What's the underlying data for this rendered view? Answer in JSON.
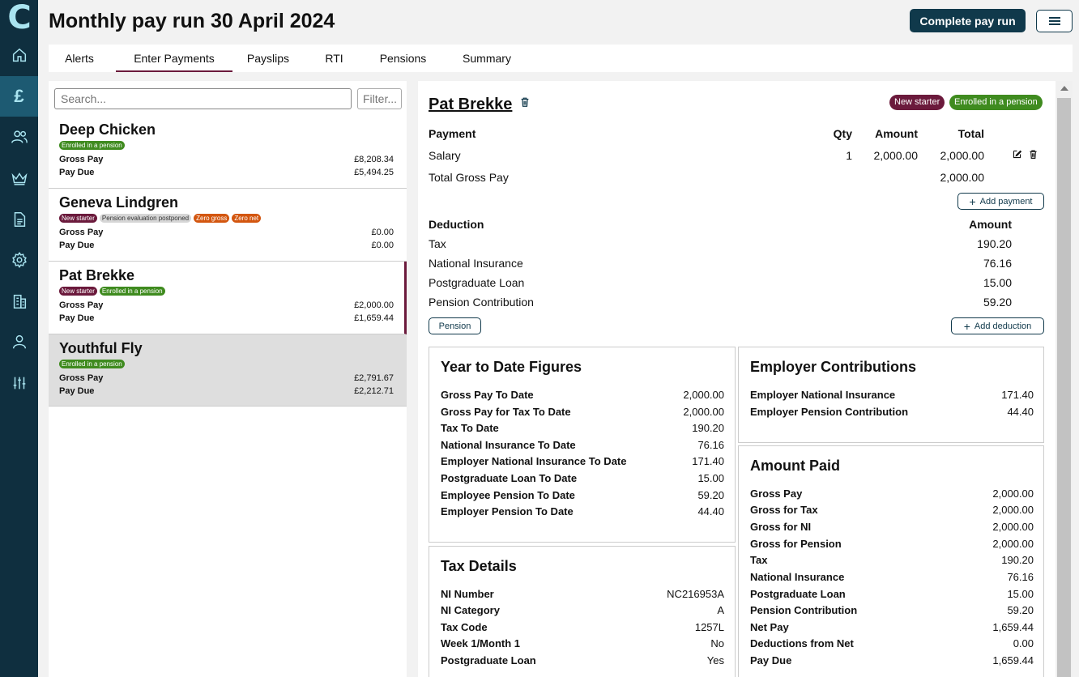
{
  "app": {
    "logo": "C",
    "title": "Monthly pay run 30 April 2024"
  },
  "header": {
    "complete_label": "Complete pay run",
    "menu_icon": "hamburger-icon"
  },
  "nav": [
    {
      "icon": "home-icon"
    },
    {
      "icon": "pound-icon",
      "symbol": "£",
      "active": true
    },
    {
      "icon": "people-icon"
    },
    {
      "icon": "crown-icon"
    },
    {
      "icon": "document-icon"
    },
    {
      "icon": "gear-icon"
    },
    {
      "icon": "building-icon"
    },
    {
      "icon": "user-icon"
    },
    {
      "icon": "sliders-icon"
    }
  ],
  "tabs": [
    {
      "label": "Alerts"
    },
    {
      "label": "Enter Payments",
      "active": true
    },
    {
      "label": "Payslips"
    },
    {
      "label": "RTI"
    },
    {
      "label": "Pensions"
    },
    {
      "label": "Summary"
    }
  ],
  "search": {
    "placeholder": "Search...",
    "filter_placeholder": "Filter..."
  },
  "employees": [
    {
      "name": "Deep Chicken",
      "badges": [
        "Enrolled in a pension"
      ],
      "gross_label": "Gross Pay",
      "gross": "£8,208.34",
      "due_label": "Pay Due",
      "due": "£5,494.25"
    },
    {
      "name": "Geneva Lindgren",
      "badges": [
        "New starter",
        "Pension evaluation postponed",
        "Zero gross",
        "Zero net"
      ],
      "gross_label": "Gross Pay",
      "gross": "£0.00",
      "due_label": "Pay Due",
      "due": "£0.00"
    },
    {
      "name": "Pat Brekke",
      "badges": [
        "New starter",
        "Enrolled in a pension"
      ],
      "gross_label": "Gross Pay",
      "gross": "£2,000.00",
      "due_label": "Pay Due",
      "due": "£1,659.44"
    },
    {
      "name": "Youthful Fly",
      "badges": [
        "Enrolled in a pension"
      ],
      "gross_label": "Gross Pay",
      "gross": "£2,791.67",
      "due_label": "Pay Due",
      "due": "£2,212.71"
    }
  ],
  "detail": {
    "name": "Pat Brekke",
    "badges": [
      "New starter",
      "Enrolled in a pension"
    ],
    "payment_headers": {
      "payment": "Payment",
      "qty": "Qty",
      "amount": "Amount",
      "total": "Total"
    },
    "payments": [
      {
        "name": "Salary",
        "qty": "1",
        "amount": "2,000.00",
        "total": "2,000.00"
      }
    ],
    "total_gross_label": "Total Gross Pay",
    "total_gross": "2,000.00",
    "add_payment": "Add payment",
    "deduction_headers": {
      "deduction": "Deduction",
      "amount": "Amount"
    },
    "deductions": [
      {
        "name": "Tax",
        "amount": "190.20"
      },
      {
        "name": "National Insurance",
        "amount": "76.16"
      },
      {
        "name": "Postgraduate Loan",
        "amount": "15.00"
      },
      {
        "name": "Pension Contribution",
        "amount": "59.20"
      }
    ],
    "pension_button": "Pension",
    "add_deduction": "Add deduction",
    "ytd": {
      "title": "Year to Date Figures",
      "rows": [
        {
          "k": "Gross Pay To Date",
          "v": "2,000.00"
        },
        {
          "k": "Gross Pay for Tax To Date",
          "v": "2,000.00"
        },
        {
          "k": "Tax To Date",
          "v": "190.20"
        },
        {
          "k": "National Insurance To Date",
          "v": "76.16"
        },
        {
          "k": "Employer National Insurance To Date",
          "v": "171.40"
        },
        {
          "k": "Postgraduate Loan To Date",
          "v": "15.00"
        },
        {
          "k": "Employee Pension To Date",
          "v": "59.20"
        },
        {
          "k": "Employer Pension To Date",
          "v": "44.40"
        }
      ]
    },
    "employer": {
      "title": "Employer Contributions",
      "rows": [
        {
          "k": "Employer National Insurance",
          "v": "171.40"
        },
        {
          "k": "Employer Pension Contribution",
          "v": "44.40"
        }
      ]
    },
    "tax": {
      "title": "Tax Details",
      "rows": [
        {
          "k": "NI Number",
          "v": "NC216953A"
        },
        {
          "k": "NI Category",
          "v": "A"
        },
        {
          "k": "Tax Code",
          "v": "1257L"
        },
        {
          "k": "Week 1/Month 1",
          "v": "No"
        },
        {
          "k": "Postgraduate Loan",
          "v": "Yes"
        }
      ]
    },
    "paid": {
      "title": "Amount Paid",
      "rows": [
        {
          "k": "Gross Pay",
          "v": "2,000.00"
        },
        {
          "k": "Gross for Tax",
          "v": "2,000.00"
        },
        {
          "k": "Gross for NI",
          "v": "2,000.00"
        },
        {
          "k": "Gross for Pension",
          "v": "2,000.00"
        },
        {
          "k": "Tax",
          "v": "190.20"
        },
        {
          "k": "National Insurance",
          "v": "76.16"
        },
        {
          "k": "Postgraduate Loan",
          "v": "15.00"
        },
        {
          "k": "Pension Contribution",
          "v": "59.20"
        },
        {
          "k": "Net Pay",
          "v": "1,659.44"
        },
        {
          "k": "Deductions from Net",
          "v": "0.00"
        },
        {
          "k": "Pay Due",
          "v": "1,659.44"
        }
      ]
    }
  },
  "colors": {
    "sidebar": "#0f2f3f",
    "accent": "#10394b",
    "maroon": "#6b1a3c",
    "green": "#3f8b1f",
    "orange": "#d3560f"
  }
}
